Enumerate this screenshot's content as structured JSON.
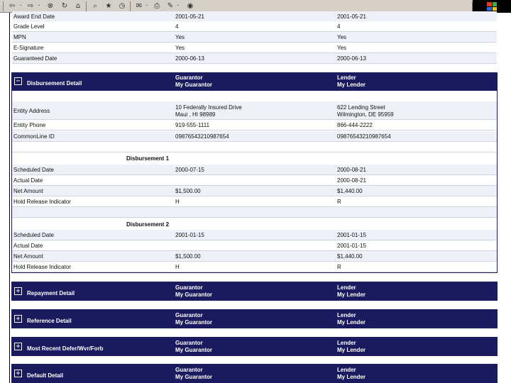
{
  "toolbar": {
    "back_icon": "back-arrow-icon",
    "forward_icon": "forward-arrow-icon"
  },
  "top_rows": [
    {
      "label": "Award End Date",
      "guarantor": "2001-05-21",
      "lender": "2001-05-21"
    },
    {
      "label": "Grade Level",
      "guarantor": "4",
      "lender": "4"
    },
    {
      "label": "MPN",
      "guarantor": "Yes",
      "lender": "Yes"
    },
    {
      "label": "E-Signature",
      "guarantor": "Yes",
      "lender": "Yes"
    },
    {
      "label": "Guaranteed Date",
      "guarantor": "2000-06-13",
      "lender": "2000-06-13"
    }
  ],
  "disbursement": {
    "title": "Disbursement Detail",
    "guarantor_heading": "Guarantor",
    "guarantor_name": "My Guarantor",
    "lender_heading": "Lender",
    "lender_name": "My Lender",
    "entity_address_label": "Entity Address",
    "guarantor_address_1": "10 Federally Insured Drive",
    "guarantor_address_2": "Maui , HI 98989",
    "lender_address_1": "622 Lending Street",
    "lender_address_2": "Wilmington, DE 95959",
    "entity_phone_label": "Entity Phone",
    "guarantor_phone": "919-555-1111",
    "lender_phone": "866-444-2222",
    "commonline_label": "CommonLine ID",
    "guarantor_commonline": "09876543210987654",
    "lender_commonline": "09876543210987654",
    "d1": {
      "heading": "Disbursement 1",
      "rows": [
        {
          "label": "Scheduled Date",
          "guarantor": "2000-07-15",
          "lender": "2000-08-21"
        },
        {
          "label": "Actual Date",
          "guarantor": "",
          "lender": "2000-08-21"
        },
        {
          "label": "Net Amount",
          "guarantor": "$1,500.00",
          "lender": "$1,440.00"
        },
        {
          "label": "Hold Release Indicator",
          "guarantor": "H",
          "lender": "R"
        }
      ]
    },
    "d2": {
      "heading": "Disbursement 2",
      "rows": [
        {
          "label": "Scheduled Date",
          "guarantor": "2001-01-15",
          "lender": "2001-01-15"
        },
        {
          "label": "Actual Date",
          "guarantor": "",
          "lender": "2001-01-15"
        },
        {
          "label": "Net Amount",
          "guarantor": "$1,500.00",
          "lender": "$1,440.00"
        },
        {
          "label": "Hold Release Indicator",
          "guarantor": "H",
          "lender": "R"
        }
      ]
    }
  },
  "sections": [
    {
      "toggle": "+",
      "title": "Repayment Detail",
      "guarantor_heading": "Guarantor",
      "guarantor_name": "My Guarantor",
      "lender_heading": "Lender",
      "lender_name": "My Lender"
    },
    {
      "toggle": "+",
      "title": "Reference Detail",
      "guarantor_heading": "Guarantor",
      "guarantor_name": "My Guarantor",
      "lender_heading": "Lender",
      "lender_name": "My Lender"
    },
    {
      "toggle": "+",
      "title": "Most Recent Defer/Wvr/Forb",
      "guarantor_heading": "Guarantor",
      "guarantor_name": "My Guarantor",
      "lender_heading": "Lender",
      "lender_name": "My Lender"
    },
    {
      "toggle": "+",
      "title": "Default Detail",
      "guarantor_heading": "Guarantor",
      "guarantor_name": "My Guarantor",
      "lender_heading": "Lender",
      "lender_name": "My Lender"
    }
  ],
  "disbursement_toggle": "−"
}
